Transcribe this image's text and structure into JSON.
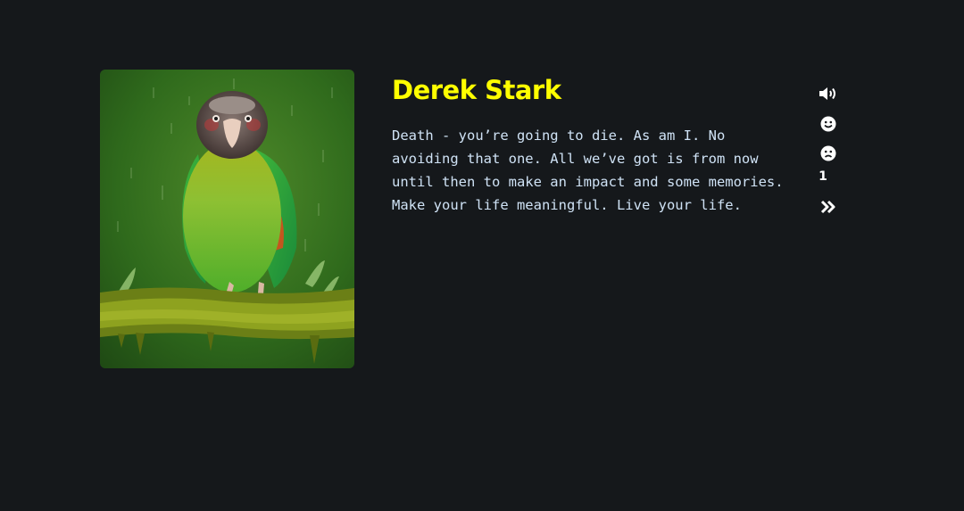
{
  "profile": {
    "name": "Derek Stark",
    "quote": "Death - you’re going to die. As am I. No avoiding that one. All we’ve got is from now until then to make an impact and some memories. Make your life meaningful. Live your life.",
    "image_subject": "parrot perched on mossy branch in rain"
  },
  "actions": {
    "speak_icon": "volume-up-icon",
    "like_icon": "smile-icon",
    "dislike_icon": "frown-icon",
    "count": "1",
    "next_icon": "double-chevron-right-icon"
  },
  "colors": {
    "background": "#15181b",
    "name": "#ffff00",
    "quote": "#cfe2f5",
    "icons": "#ffffff"
  }
}
